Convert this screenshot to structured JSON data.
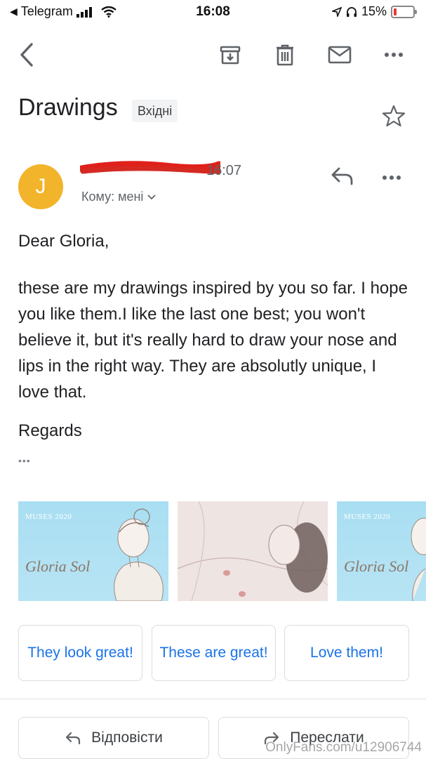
{
  "status_bar": {
    "back_app": "Telegram",
    "time": "16:08",
    "battery": "15%",
    "battery_level": 0.15,
    "battery_color": "#e53935"
  },
  "toolbar": {
    "back_icon": "back-arrow-icon",
    "archive_icon": "archive-icon",
    "delete_icon": "trash-icon",
    "mark_unread_icon": "mail-icon",
    "more_icon": "more-horizontal-icon"
  },
  "email": {
    "subject": "Drawings",
    "label": "Вхідні",
    "star_icon": "star-outline-icon",
    "avatar_letter": "J",
    "avatar_color": "#f2b42a",
    "time": "16:07",
    "recipient": "Кому: мені",
    "body": {
      "greeting": "Dear Gloria,",
      "paragraph": "these are my drawings inspired by you so far. I hope you like them.I like the last one best; you won't believe it, but it's really hard to draw your nose and lips in the right way. They are absolutly unique, I love that.",
      "closing": "Regards",
      "ellipsis": "•••"
    }
  },
  "attachments": [
    {
      "kind": "MUSES 2020",
      "caption": "Gloria Sol"
    },
    {
      "kind": "",
      "caption": ""
    },
    {
      "kind": "MUSES 2020",
      "caption": "Gloria Sol"
    }
  ],
  "smart_replies": [
    "They look great!",
    "These are great!",
    "Love them!"
  ],
  "actions": {
    "reply": "Відповісти",
    "forward": "Переслати"
  },
  "watermark": "OnlyFans.com/u12906744",
  "colors": {
    "accent": "#1a73e8",
    "text": "#202124",
    "secondary": "#5f6368"
  }
}
